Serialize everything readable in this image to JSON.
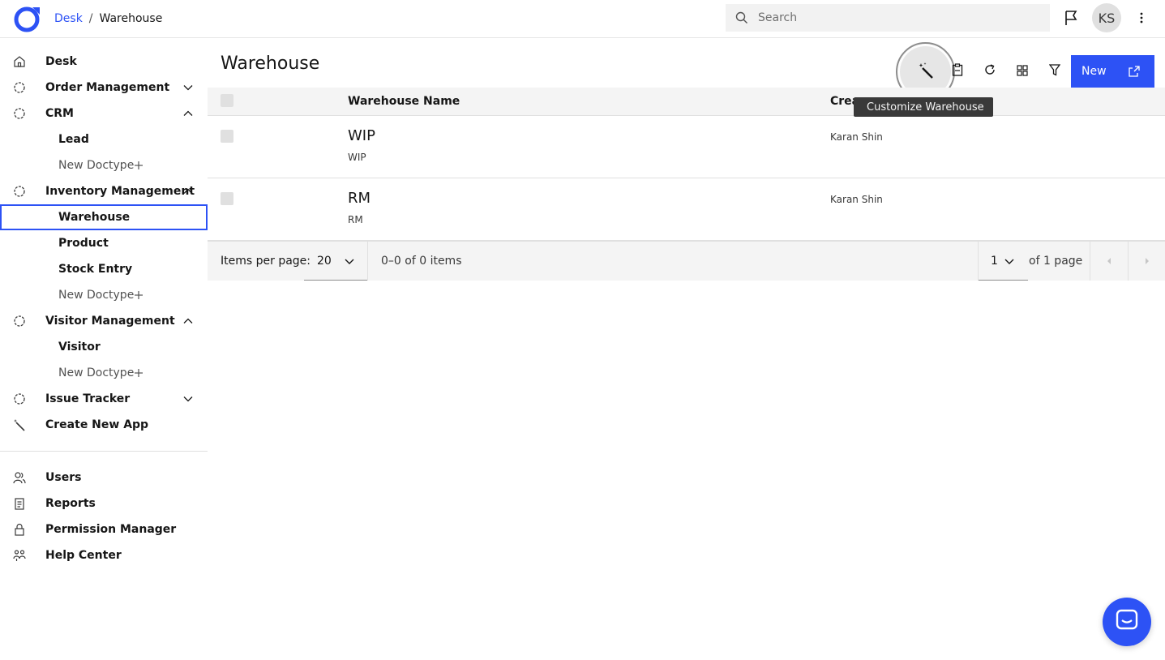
{
  "header": {
    "breadcrumb": {
      "root": "Desk",
      "separator": "/",
      "current": "Warehouse"
    },
    "search_placeholder": "Search",
    "avatar_initials": "KS",
    "icons": [
      "logo-icon",
      "search-icon",
      "flag-icon",
      "overflow-menu-icon"
    ]
  },
  "sidebar": {
    "items": [
      {
        "label": "Desk",
        "icon": "home-icon"
      },
      {
        "label": "Order Management",
        "icon": "app-circle-icon",
        "expanded": false
      },
      {
        "label": "CRM",
        "icon": "app-circle-icon",
        "expanded": true,
        "children": [
          "Lead",
          "New Doctype"
        ]
      },
      {
        "label": "Inventory Management",
        "icon": "app-circle-icon",
        "expanded": true,
        "children": [
          "Warehouse",
          "Product",
          "Stock Entry",
          "New Doctype"
        ]
      },
      {
        "label": "Visitor Management",
        "icon": "app-circle-icon",
        "expanded": true,
        "children": [
          "Visitor",
          "New Doctype"
        ]
      },
      {
        "label": "Issue Tracker",
        "icon": "app-circle-icon",
        "expanded": false
      },
      {
        "label": "Create New App",
        "icon": "magic-wand-icon"
      }
    ],
    "footer": [
      {
        "label": "Users",
        "icon": "users-icon"
      },
      {
        "label": "Reports",
        "icon": "report-icon"
      },
      {
        "label": "Permission Manager",
        "icon": "lock-icon"
      },
      {
        "label": "Help Center",
        "icon": "help-people-icon"
      }
    ],
    "active_item": "Warehouse"
  },
  "main": {
    "title": "Warehouse",
    "toolbar": {
      "customize_tooltip": "Customize Warehouse",
      "new_label": "New",
      "icons": [
        "magic-wand-icon",
        "clipboard-icon",
        "refresh-icon",
        "grid-icon",
        "filter-icon",
        "launch-icon"
      ]
    },
    "table": {
      "columns": [
        "Warehouse Name",
        "Crea"
      ],
      "rows": [
        {
          "title": "WIP",
          "subtitle": "WIP",
          "created_by": "Karan Shin"
        },
        {
          "title": "RM",
          "subtitle": "RM",
          "created_by": "Karan Shin"
        }
      ]
    },
    "pagination": {
      "items_per_page_label": "Items per page:",
      "items_per_page": "20",
      "range_text": "0–0 of 0 items",
      "page": "1",
      "of_pages": "of 1 page"
    }
  },
  "colors": {
    "accent": "#2d52f5",
    "header_bg": "#f4f4f4",
    "tooltip_bg": "#393939"
  }
}
